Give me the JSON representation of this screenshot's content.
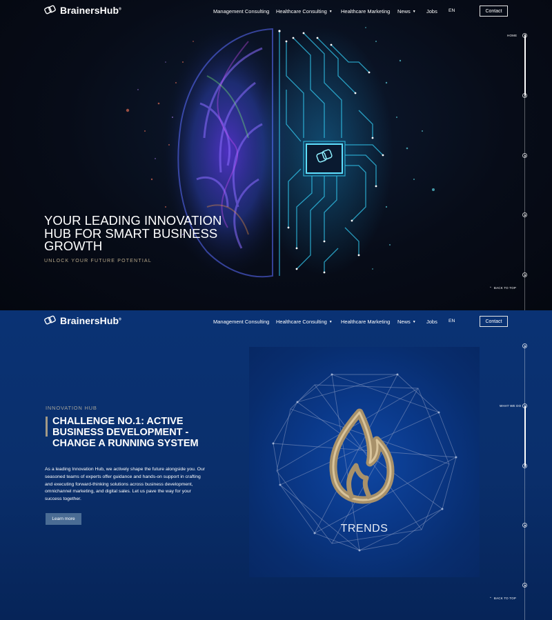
{
  "brand": {
    "name": "BrainersHub",
    "mark": "®"
  },
  "nav": {
    "items": [
      {
        "label": "Management Consulting",
        "dropdown": false
      },
      {
        "label": "Healthcare Consulting",
        "dropdown": true
      },
      {
        "label": "Healthcare Marketing",
        "dropdown": false
      },
      {
        "label": "News",
        "dropdown": true
      },
      {
        "label": "Jobs",
        "dropdown": false
      }
    ],
    "language": "EN",
    "contact": "Contact"
  },
  "hero": {
    "title": "YOUR LEADING INNOVATION HUB FOR SMART BUSINESS GROWTH",
    "subtitle": "UNLOCK YOUR FUTURE POTENTIAL",
    "section_label": "HOME",
    "back_to_top": "BACK TO TOP"
  },
  "services": {
    "eyebrow": "INNOVATION HUB",
    "title": "CHALLENGE NO.1: ACTIVE BUSINESS DEVELOPMENT - CHANGE A RUNNING SYSTEM",
    "body": "As a leading Innovation Hub, we actively shape the future alongside you. Our seasoned teams of experts offer guidance and hands-on support in crafting and executing forward-thinking solutions across business development, omnichannel marketing, and digital sales. Let us pave the way for your success together.",
    "button": "Learn more",
    "card_label": "TRENDS",
    "section_label": "WHAT WE DO",
    "back_to_top": "BACK TO TOP"
  },
  "colors": {
    "hero_bg": "#070c18",
    "services_bg": "#0a3274",
    "accent_gold": "#b7a88a",
    "button_bg": "#4a6c94"
  },
  "icons": [
    "brainershub-logo-icon",
    "chevron-down-icon",
    "arrow-up-icon",
    "brain-chip-illustration",
    "trends-flame-icon"
  ]
}
